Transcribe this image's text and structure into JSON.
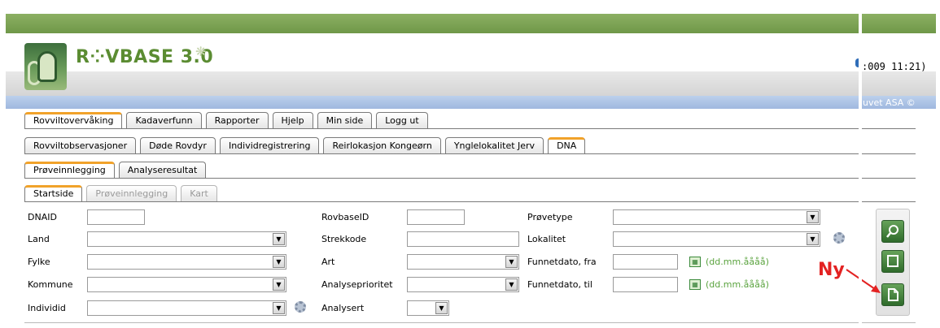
{
  "header": {
    "app_title": "R⁘VBASE 3.0",
    "clock": ":009 11:21)",
    "copyright": "uvet ASA ©"
  },
  "main_tabs": [
    "Rovviltovervåking",
    "Kadaverfunn",
    "Rapporter",
    "Hjelp",
    "Min side",
    "Logg ut"
  ],
  "sub_tabs": [
    "Rovviltobservasjoner",
    "Døde Rovdyr",
    "Individregistrering",
    "Reirlokasjon Kongeørn",
    "Ynglelokalitet Jerv",
    "DNA"
  ],
  "dna_tabs": [
    "Prøveinnlegging",
    "Analyseresultat"
  ],
  "page_tabs": [
    "Startside",
    "Prøveinnlegging",
    "Kart"
  ],
  "form": {
    "dnaid_label": "DNAID",
    "land_label": "Land",
    "fylke_label": "Fylke",
    "kommune_label": "Kommune",
    "individ_label": "Individid",
    "rovbaseid_label": "RovbaseID",
    "strekkode_label": "Strekkode",
    "art_label": "Art",
    "analyseprioritet_label": "Analyseprioritet",
    "analysert_label": "Analysert",
    "provetype_label": "Prøvetype",
    "lokalitet_label": "Lokalitet",
    "funnetdato_fra_label": "Funnetdato, fra",
    "funnetdato_til_label": "Funnetdato, til",
    "date_format_hint": "(dd.mm.åååå)"
  },
  "side_buttons": {
    "search": "search-icon",
    "clear": "clear-icon",
    "new": "new-document-icon"
  },
  "annotation": {
    "ny_label": "Ny"
  },
  "colors": {
    "brand_green": "#5b8c32",
    "active_tab_accent": "#f1a22a",
    "date_hint": "#5aa33e",
    "annotation_red": "#e32222"
  }
}
